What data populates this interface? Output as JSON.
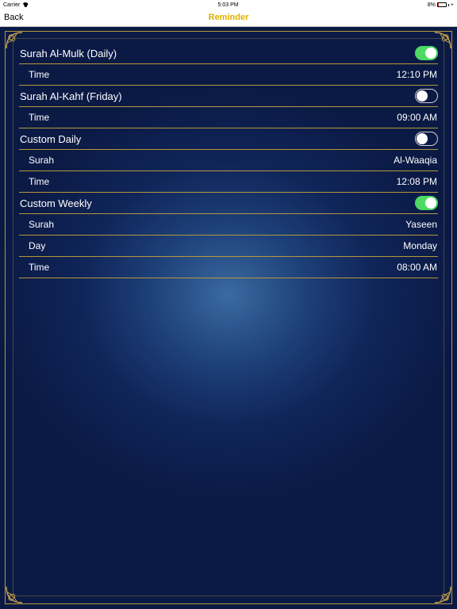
{
  "status_bar": {
    "carrier": "Carrier",
    "time": "5:03 PM",
    "battery_percent": "8%",
    "battery_level": 0.08
  },
  "nav": {
    "back_label": "Back",
    "title": "Reminder"
  },
  "reminders": {
    "mulk": {
      "label": "Surah Al-Mulk (Daily)",
      "enabled": true,
      "time_label": "Time",
      "time_value": "12:10 PM"
    },
    "kahf": {
      "label": "Surah Al-Kahf (Friday)",
      "enabled": false,
      "time_label": "Time",
      "time_value": "09:00 AM"
    },
    "custom_daily": {
      "label": "Custom Daily",
      "enabled": false,
      "surah_label": "Surah",
      "surah_value": "Al-Waaqia",
      "time_label": "Time",
      "time_value": "12:08 PM"
    },
    "custom_weekly": {
      "label": "Custom Weekly",
      "enabled": true,
      "surah_label": "Surah",
      "surah_value": "Yaseen",
      "day_label": "Day",
      "day_value": "Monday",
      "time_label": "Time",
      "time_value": "08:00 AM"
    }
  },
  "colors": {
    "accent_gold": "#b8973a",
    "title_gold": "#e0b000",
    "toggle_on": "#4cd964",
    "background_dark": "#0b1a45"
  }
}
